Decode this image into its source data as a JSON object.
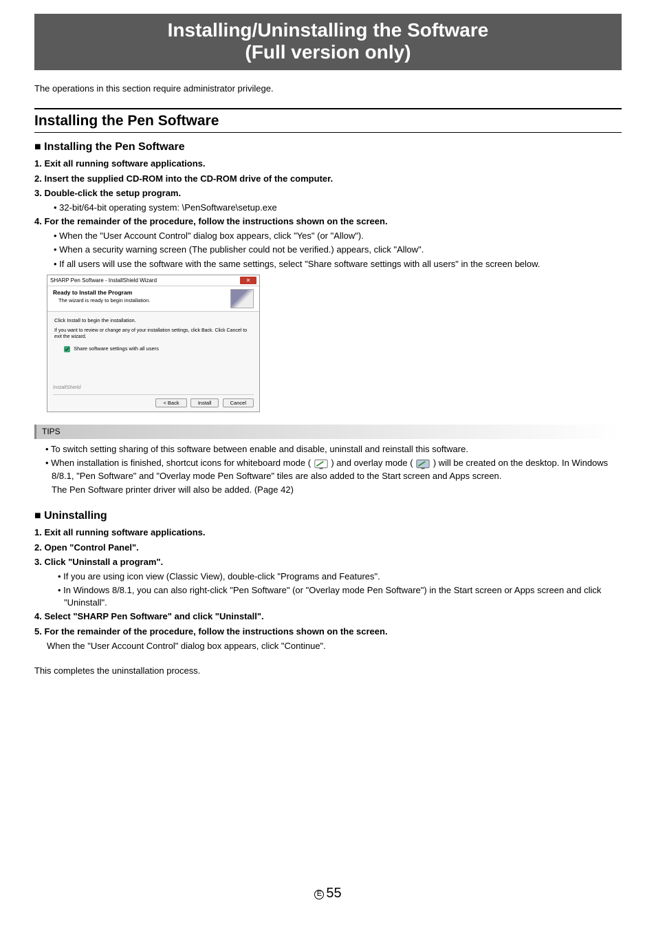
{
  "title": {
    "line1": "Installing/Uninstalling the Software",
    "line2": "(Full version only)"
  },
  "intro": "The operations in this section require administrator privilege.",
  "section1": {
    "heading": "Installing the Pen Software",
    "sub1": {
      "heading": "Installing the Pen Software",
      "steps": {
        "s1": "1. Exit all running software applications.",
        "s2": "2. Insert the supplied CD-ROM into the CD-ROM drive of the computer.",
        "s3": "3. Double-click the setup program.",
        "s3b": "• 32-bit/64-bit operating system: \\PenSoftware\\setup.exe",
        "s4": "4. For the remainder of the procedure, follow the instructions shown on the screen.",
        "s4b1": "• When the \"User Account Control\" dialog box appears, click \"Yes\" (or \"Allow\").",
        "s4b2": "• When a security warning screen (The publisher could not be verified.) appears, click \"Allow\".",
        "s4b3": "• If all users will use the software with the same settings, select \"Share software settings with all users\" in the screen below."
      }
    },
    "wizard": {
      "windowTitle": "SHARP Pen Software - InstallShield Wizard",
      "headerTitle": "Ready to Install the Program",
      "headerSub": "The wizard is ready to begin installation.",
      "bodyLine": "Click Install to begin the installation.",
      "bodySub": "If you want to review or change any of your installation settings, click Back. Click Cancel to exit the wizard.",
      "checkbox": "Share software settings with all users",
      "brand": "InstallShield",
      "btnBack": "< Back",
      "btnInstall": "Install",
      "btnCancel": "Cancel"
    },
    "tips": {
      "label": "TIPS",
      "t1": "• To switch setting sharing of this software between enable and disable, uninstall and reinstall this software.",
      "t2a": "• When installation is finished, shortcut icons for whiteboard mode (",
      "t2b": ") and overlay mode (",
      "t2c": ") will be created on the desktop. In Windows 8/8.1, \"Pen Software\" and \"Overlay mode Pen Software\" tiles are also added to the Start screen and Apps screen.",
      "t2d": "The Pen Software printer driver will also be added. (Page 42)"
    },
    "sub2": {
      "heading": "Uninstalling",
      "steps": {
        "s1": "1. Exit all running software applications.",
        "s2": "2. Open \"Control Panel\".",
        "s3": "3. Click \"Uninstall a program\".",
        "s3b1": "• If you are using icon view (Classic View), double-click \"Programs and Features\".",
        "s3b2": "• In Windows 8/8.1, you can also right-click \"Pen Software\" (or \"Overlay mode Pen Software\") in the Start screen or Apps screen and click \"Uninstall\".",
        "s4": "4. Select \"SHARP Pen Software\" and click \"Uninstall\".",
        "s5": "5. For the remainder of the procedure, follow the instructions shown on the screen.",
        "s5b": "When the \"User Account Control\" dialog box appears, click \"Continue\"."
      },
      "closing": "This completes the uninstallation process."
    }
  },
  "page": {
    "letter": "E",
    "number": "55"
  }
}
